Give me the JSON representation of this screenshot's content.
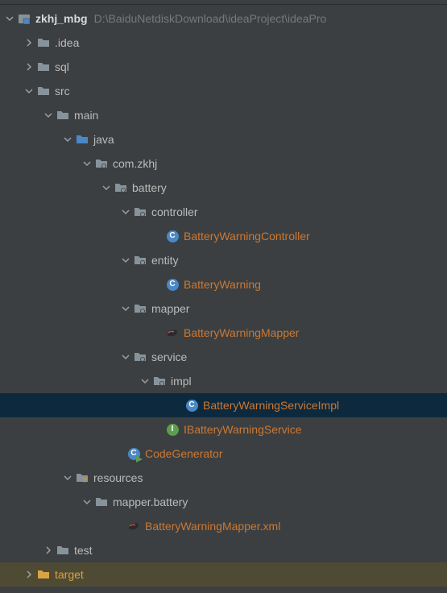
{
  "project": {
    "name": "zkhj_mbg",
    "path": "D:\\BaiduNetdiskDownload\\ideaProject\\ideaPro"
  },
  "nodes": {
    "idea": ".idea",
    "sql": "sql",
    "src": "src",
    "main": "main",
    "java": "java",
    "pkg_zkhj": "com.zkhj",
    "pkg_battery": "battery",
    "pkg_controller": "controller",
    "cls_bw_controller": "BatteryWarningController",
    "pkg_entity": "entity",
    "cls_bw": "BatteryWarning",
    "pkg_mapper": "mapper",
    "cls_bw_mapper": "BatteryWarningMapper",
    "pkg_service": "service",
    "pkg_impl": "impl",
    "cls_bw_service_impl": "BatteryWarningServiceImpl",
    "cls_ibw_service": "IBatteryWarningService",
    "cls_codegen": "CodeGenerator",
    "resources": "resources",
    "pkg_mapper_battery": "mapper.battery",
    "file_mapper_xml": "BatteryWarningMapper.xml",
    "test": "test",
    "target": "target"
  }
}
